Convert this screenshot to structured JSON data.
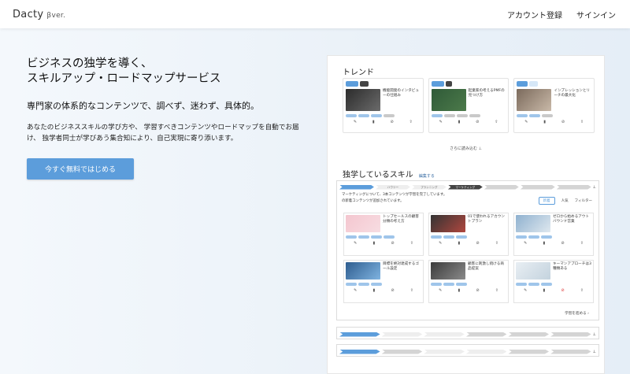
{
  "header": {
    "logo": "Dacty",
    "logo_ver": "βver.",
    "nav": [
      "アカウント登録",
      "サインイン"
    ]
  },
  "hero": {
    "title_line1": "ビジネスの独学を導く、",
    "title_line2": "スキルアップ・ロードマップサービス",
    "subtitle": "専門家の体系的なコンテンツで、調べず、迷わず、具体的。",
    "desc_line1": "あなたのビジネススキルの学び方や、 学習すべきコンテンツやロードマップを自動でお届",
    "desc_line2": "け、 独学者同士が学びあう集合知により、自己実現に寄り添います。",
    "cta": "今すぐ無料ではじめる"
  },
  "panel": {
    "trend_title": "トレンド",
    "read_more": "さらに読み込む",
    "skills_title": "独学しているスキル",
    "skills_edit": "編集する",
    "notice": "マーケティングについて、3本コンテンツが学習を完了しています。",
    "notice2": "の新着コンテンツが追加されています。",
    "sort": [
      "新着",
      "人気",
      "フィルター"
    ],
    "next_step": "学習を進める",
    "trend_cards": [
      {
        "text": "機能開発のインタビューの仕組み"
      },
      {
        "text": "起業家の考えるPMFの見つけ方"
      },
      {
        "text": "インプレッションとリーチの最大化"
      }
    ],
    "grid_cards": [
      {
        "text": "トップセールスの顧客分類の考え方"
      },
      {
        "text": "01で使われるアカウントプラン"
      },
      {
        "text": "ゼロから始めるアウトバウンド営業"
      },
      {
        "text": "目標を絶対達成するゴール設定"
      },
      {
        "text": "顧客に刺激し続ける商品提案"
      },
      {
        "text": "キーマンアプローチは3種類ある"
      }
    ],
    "roadmap_steps": [
      "ハウツー",
      "プランニング",
      "マーケティング"
    ]
  },
  "colors": {
    "accent": "#5c9ddb",
    "dark_tag": "#444444"
  }
}
